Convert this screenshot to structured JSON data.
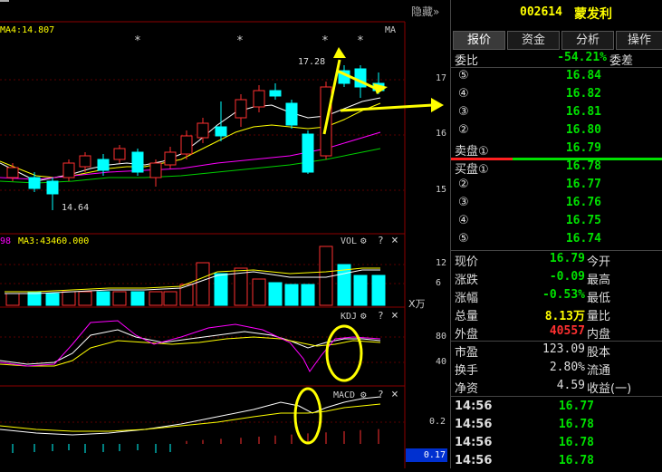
{
  "stock": {
    "code": "002614",
    "name": "蒙发利"
  },
  "header": {
    "hide_label": "隐藏"
  },
  "main_chart": {
    "ma_label": "MA4:14.807",
    "ma_button": "MA",
    "high_label": "17.28",
    "low_label": "14.64",
    "stars": [
      "*",
      "*",
      "*",
      "*"
    ],
    "price_ticks": [
      "17",
      "16",
      "15"
    ]
  },
  "vol_chart": {
    "prefix_label": "98",
    "ma_label": "MA3:43460.000",
    "title": "VOL",
    "ticks": [
      "12",
      "6"
    ],
    "unit": "X万"
  },
  "kdj_chart": {
    "title": "KDJ",
    "ticks": [
      "80",
      "40"
    ]
  },
  "macd_chart": {
    "title": "MACD",
    "ticks": [
      "0.2"
    ],
    "value_box": "0.17"
  },
  "icons": {
    "gear": "⚙",
    "help": "?",
    "close": "×"
  },
  "tabs": [
    {
      "label": "报价",
      "active": true
    },
    {
      "label": "资金",
      "active": false
    },
    {
      "label": "分析",
      "active": false
    },
    {
      "label": "操作",
      "active": false
    }
  ],
  "ratio": {
    "label": "委比",
    "value": "-54.21%",
    "label2": "委差"
  },
  "sell_orders": [
    {
      "level": "⑤",
      "price": "16.84"
    },
    {
      "level": "④",
      "price": "16.82"
    },
    {
      "level": "③",
      "price": "16.81"
    },
    {
      "level": "②",
      "price": "16.80"
    },
    {
      "level": "卖盘①",
      "price": "16.79"
    }
  ],
  "buy_orders": [
    {
      "level": "买盘①",
      "price": "16.78"
    },
    {
      "level": "②",
      "price": "16.77"
    },
    {
      "level": "③",
      "price": "16.76"
    },
    {
      "level": "④",
      "price": "16.75"
    },
    {
      "level": "⑤",
      "price": "16.74"
    }
  ],
  "stats": [
    {
      "label": "现价",
      "value": "16.79",
      "color": "#00e000",
      "label2": "今开"
    },
    {
      "label": "涨跌",
      "value": "-0.09",
      "color": "#00e000",
      "label2": "最高"
    },
    {
      "label": "涨幅",
      "value": "-0.53%",
      "color": "#00e000",
      "label2": "最低"
    },
    {
      "label": "总量",
      "value": "8.13万",
      "color": "#ffff00",
      "label2": "量比"
    },
    {
      "label": "外盘",
      "value": "40557",
      "color": "#ff3030",
      "label2": "内盘"
    }
  ],
  "stats2": [
    {
      "label": "市盈",
      "value": "123.09",
      "label2": "股本"
    },
    {
      "label": "换手",
      "value": "2.80%",
      "label2": "流通"
    },
    {
      "label": "净资",
      "value": "4.59",
      "label2": "收益(一)"
    }
  ],
  "ticks": [
    {
      "time": "14:56",
      "price": "16.77"
    },
    {
      "time": "14:56",
      "price": "16.78"
    },
    {
      "time": "14:56",
      "price": "16.78"
    },
    {
      "time": "14:56",
      "price": "16.78"
    }
  ],
  "colors": {
    "up": "#ff3030",
    "down": "#00ffff",
    "green": "#00e000",
    "yellow": "#ffff00",
    "magenta": "#ff00ff",
    "annotation": "#ffff00"
  }
}
